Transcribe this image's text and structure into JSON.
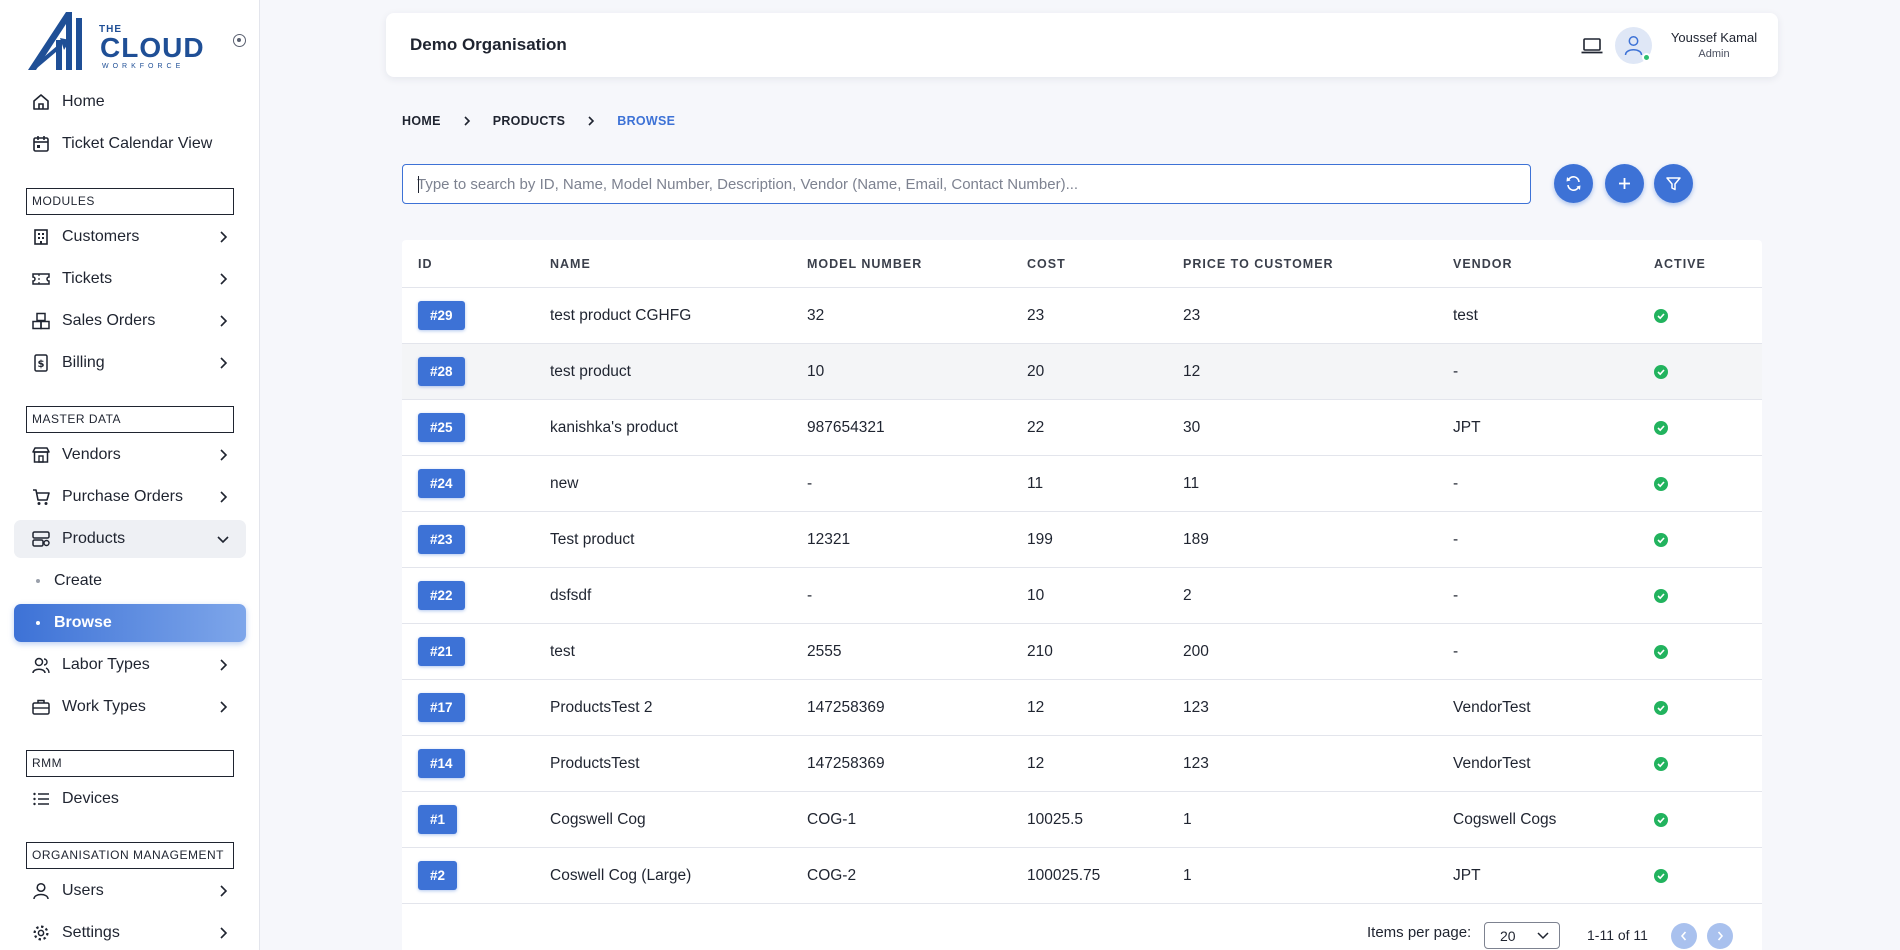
{
  "colors": {
    "accent": "#3d72d6",
    "active_green": "#22b35e",
    "sidebar_bg": "#ffffff",
    "page_bg": "#f6f7fb"
  },
  "logo": {
    "the": "THE",
    "cloud": "CLOUD",
    "workforce": "WORKFORCE"
  },
  "sidebar": {
    "top_items": [
      {
        "label": "Home",
        "icon": "home-icon"
      },
      {
        "label": "Ticket Calendar View",
        "icon": "calendar-icon"
      }
    ],
    "sections": {
      "modules": "MODULES",
      "master_data": "MASTER DATA",
      "rmm": "RMM",
      "org_management": "ORGANISATION MANAGEMENT"
    },
    "modules_items": [
      {
        "label": "Customers",
        "icon": "building-icon"
      },
      {
        "label": "Tickets",
        "icon": "ticket-icon"
      },
      {
        "label": "Sales Orders",
        "icon": "boxes-icon"
      },
      {
        "label": "Billing",
        "icon": "dollar-receipt-icon"
      }
    ],
    "master_items": [
      {
        "label": "Vendors",
        "icon": "store-icon"
      },
      {
        "label": "Purchase Orders",
        "icon": "cart-icon"
      },
      {
        "label": "Products",
        "icon": "products-icon"
      }
    ],
    "products_sub": [
      {
        "label": "Create"
      },
      {
        "label": "Browse"
      }
    ],
    "master_items_after": [
      {
        "label": "Labor Types",
        "icon": "people-icon"
      },
      {
        "label": "Work Types",
        "icon": "briefcase-icon"
      }
    ],
    "rmm_items": [
      {
        "label": "Devices",
        "icon": "list-icon"
      }
    ],
    "org_items": [
      {
        "label": "Users",
        "icon": "user-icon"
      },
      {
        "label": "Settings",
        "icon": "gear-icon"
      }
    ]
  },
  "header": {
    "org_name": "Demo Organisation",
    "user_name": "Youssef Kamal",
    "user_role": "Admin"
  },
  "breadcrumb": {
    "home": "HOME",
    "products": "PRODUCTS",
    "browse": "BROWSE"
  },
  "search": {
    "value": "",
    "placeholder": "Type to search by ID, Name, Model Number, Description, Vendor (Name, Email, Contact Number)..."
  },
  "table": {
    "columns": [
      "ID",
      "NAME",
      "MODEL NUMBER",
      "COST",
      "PRICE TO CUSTOMER",
      "VENDOR",
      "ACTIVE"
    ],
    "rows": [
      {
        "id": "#29",
        "name": "test product CGHFG",
        "model": "32",
        "cost": "23",
        "price": "23",
        "vendor": "test"
      },
      {
        "id": "#28",
        "name": "test product",
        "model": "10",
        "cost": "20",
        "price": "12",
        "vendor": "-"
      },
      {
        "id": "#25",
        "name": "kanishka's product",
        "model": "987654321",
        "cost": "22",
        "price": "30",
        "vendor": "JPT"
      },
      {
        "id": "#24",
        "name": "new",
        "model": "-",
        "cost": "11",
        "price": "11",
        "vendor": "-"
      },
      {
        "id": "#23",
        "name": "Test product",
        "model": "12321",
        "cost": "199",
        "price": "189",
        "vendor": "-"
      },
      {
        "id": "#22",
        "name": "dsfsdf",
        "model": "-",
        "cost": "10",
        "price": "2",
        "vendor": "-"
      },
      {
        "id": "#21",
        "name": "test",
        "model": "2555",
        "cost": "210",
        "price": "200",
        "vendor": "-"
      },
      {
        "id": "#17",
        "name": "ProductsTest 2",
        "model": "147258369",
        "cost": "12",
        "price": "123",
        "vendor": "VendorTest"
      },
      {
        "id": "#14",
        "name": "ProductsTest",
        "model": "147258369",
        "cost": "12",
        "price": "123",
        "vendor": "VendorTest"
      },
      {
        "id": "#1",
        "name": "Cogswell Cog",
        "model": "COG-1",
        "cost": "10025.5",
        "price": "1",
        "vendor": "Cogswell Cogs"
      },
      {
        "id": "#2",
        "name": "Coswell Cog (Large)",
        "model": "COG-2",
        "cost": "100025.75",
        "price": "1",
        "vendor": "JPT"
      }
    ]
  },
  "pagination": {
    "items_per_page_label": "Items per page:",
    "items_per_page": "20",
    "range": "1-11 of 11"
  }
}
